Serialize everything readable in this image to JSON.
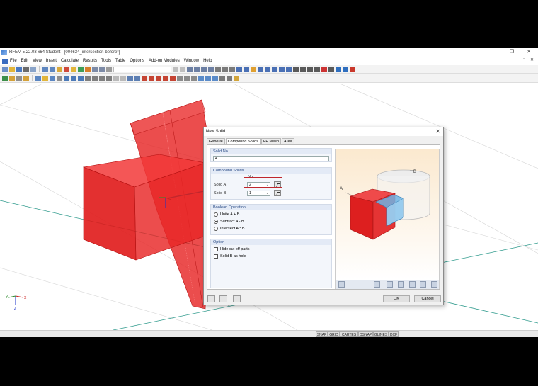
{
  "window": {
    "title": "RFEM 5.22.03 x64 Student - [004634_intersection-before*]",
    "controls": [
      "–",
      "❐",
      "✕"
    ],
    "mdi_controls": [
      "–",
      "▫",
      "✕"
    ]
  },
  "menu": [
    "File",
    "Edit",
    "View",
    "Insert",
    "Calculate",
    "Results",
    "Tools",
    "Table",
    "Options",
    "Add-on Modules",
    "Window",
    "Help"
  ],
  "viewport": {
    "axes": {
      "x": "X",
      "y": "Y",
      "z": "Z"
    },
    "node_marker": "2"
  },
  "statusbar": [
    "SNAP",
    "GRID",
    "CARTES",
    "OSNAP",
    "GLINES",
    "DXF"
  ],
  "dialog": {
    "title": "New Solid",
    "close": "✕",
    "tabs": [
      "General",
      "Compound Solids",
      "FE Mesh",
      "Area"
    ],
    "active_tab": "Compound Solids",
    "solid_no_group": "Solid No.",
    "solid_no_value": "4",
    "compound_group": "Compound Solids",
    "no_header": "No.",
    "solid_a_label": "Solid A",
    "solid_a_value": "2",
    "solid_b_label": "Solid B",
    "solid_b_value": "1",
    "boolean_group": "Boolean Operation",
    "boolean_options": [
      "Unite A + B",
      "Subtract A - B",
      "Intersect A * B"
    ],
    "boolean_selected": 1,
    "option_group": "Option",
    "options": [
      "Hide cut off parts",
      "Solid B as hole"
    ],
    "preview_labels": {
      "a": "A",
      "b": "B"
    },
    "ok": "OK",
    "cancel": "Cancel"
  },
  "colors": {
    "solid_red": "#e51b1b",
    "highlight": "#c0272d",
    "grid_line": "#2e9a8c"
  }
}
